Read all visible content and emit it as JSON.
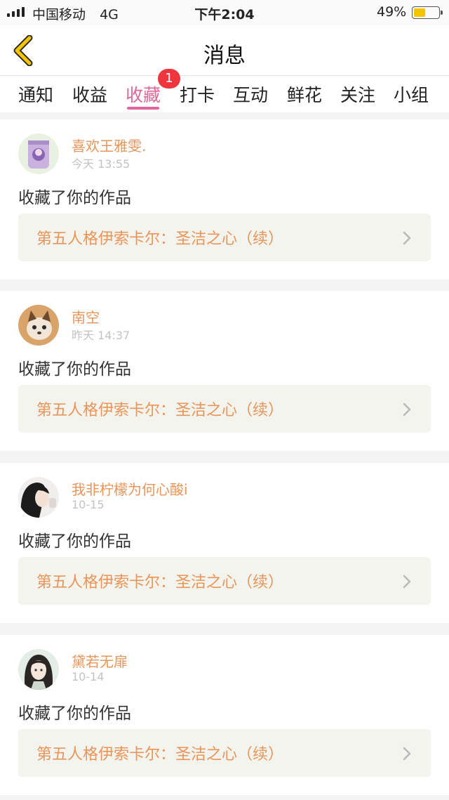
{
  "status_bar": {
    "carrier": "中国移动",
    "network": "4G",
    "time": "下午2:04",
    "battery_percent": "49%",
    "battery_level": 0.49,
    "battery_color": "#f5c400"
  },
  "header": {
    "title": "消息",
    "back_icon": "chevron-left-icon",
    "back_icon_color": "#f5c400"
  },
  "tabs": [
    {
      "label": "通知",
      "active": false
    },
    {
      "label": "收益",
      "active": false
    },
    {
      "label": "收藏",
      "active": true,
      "badge": "1"
    },
    {
      "label": "打卡",
      "active": false
    },
    {
      "label": "互动",
      "active": false
    },
    {
      "label": "鲜花",
      "active": false
    },
    {
      "label": "关注",
      "active": false
    },
    {
      "label": "小组",
      "active": false
    }
  ],
  "colors": {
    "accent_tab": "#e0679b",
    "username": "#e8955a",
    "badge": "#f0353d"
  },
  "messages": [
    {
      "username": "喜欢王雅雯.",
      "time": "今天 13:55",
      "action": "收藏了你的作品",
      "work_title": "第五人格伊索卡尔：圣洁之心（续）",
      "avatar_icon": "avatar-purple-drink"
    },
    {
      "username": "南空",
      "time": "昨天 14:37",
      "action": "收藏了你的作品",
      "work_title": "第五人格伊索卡尔：圣洁之心（续）",
      "avatar_icon": "avatar-cat"
    },
    {
      "username": "我非柠檬为何心酸i",
      "time": "10-15",
      "action": "收藏了你的作品",
      "work_title": "第五人格伊索卡尔：圣洁之心（续）",
      "avatar_icon": "avatar-girl-dark-hair"
    },
    {
      "username": "黛若无扉",
      "time": "10-14",
      "action": "收藏了你的作品",
      "work_title": "第五人格伊索卡尔：圣洁之心（续）",
      "avatar_icon": "avatar-anime-girl"
    }
  ]
}
